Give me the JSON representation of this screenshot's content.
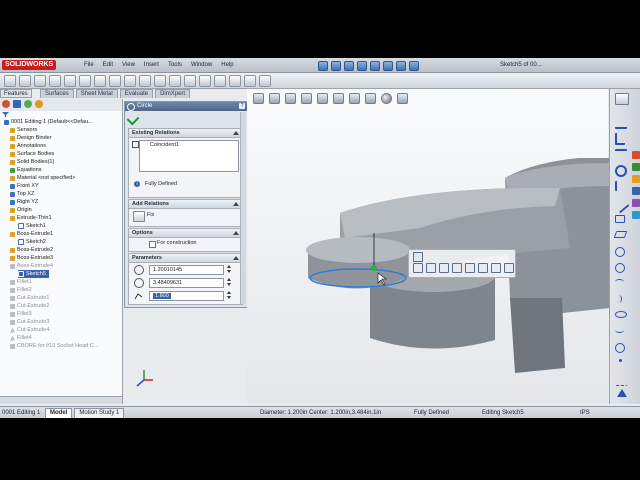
{
  "app": {
    "name": "SOLIDWORKS"
  },
  "menu": [
    "File",
    "Edit",
    "View",
    "Insert",
    "Tools",
    "Window",
    "Help"
  ],
  "document_title": "Sketch5 of 00...",
  "command_tabs": [
    "Features",
    "Surfaces",
    "Sheet Metal",
    "Evaluate",
    "DimXpert"
  ],
  "tree": {
    "root": "0001 Editing 1 (Default<<Defau...",
    "items": [
      {
        "label": "Sensors",
        "state": "normal"
      },
      {
        "label": "Design Binder",
        "state": "normal"
      },
      {
        "label": "Annotations",
        "state": "normal"
      },
      {
        "label": "Surface Bodies",
        "state": "normal"
      },
      {
        "label": "Solid Bodies(1)",
        "state": "normal"
      },
      {
        "label": "Equations",
        "state": "normal"
      },
      {
        "label": "Material <not specified>",
        "state": "normal"
      },
      {
        "label": "Front XY",
        "state": "normal"
      },
      {
        "label": "Top XZ",
        "state": "normal"
      },
      {
        "label": "Right YZ",
        "state": "normal"
      },
      {
        "label": "Origin",
        "state": "normal"
      },
      {
        "label": "Extrude-Thin1",
        "state": "normal"
      },
      {
        "label": "Sketch1",
        "state": "normal"
      },
      {
        "label": "Boss-Extrude1",
        "state": "normal"
      },
      {
        "label": "Sketch2",
        "state": "normal"
      },
      {
        "label": "Boss-Extrude2",
        "state": "normal"
      },
      {
        "label": "Boss-Extrude3",
        "state": "normal"
      },
      {
        "label": "Boss-Extrude4",
        "state": "dim"
      },
      {
        "label": "Sketch5",
        "state": "selected"
      },
      {
        "label": "Fillet1",
        "state": "dim"
      },
      {
        "label": "Fillet2",
        "state": "dim"
      },
      {
        "label": "Cut-Extrude1",
        "state": "dim"
      },
      {
        "label": "Cut-Extrude2",
        "state": "dim"
      },
      {
        "label": "Fillet3",
        "state": "dim"
      },
      {
        "label": "Cut-Extrude3",
        "state": "dim"
      },
      {
        "label": "Cut-Extrude4",
        "state": "dim"
      },
      {
        "label": "Fillet4",
        "state": "dim"
      },
      {
        "label": "CBORE for #10 Socket Head C...",
        "state": "dim"
      }
    ]
  },
  "property_manager": {
    "title": "Circle",
    "help": "?",
    "existing_relations": {
      "title": "Existing Relations",
      "items": [
        "Coincident1"
      ],
      "status": "Fully Defined"
    },
    "add_relations": {
      "title": "Add Relations",
      "items": [
        "Fix"
      ]
    },
    "options": {
      "title": "Options",
      "for_construction": "For construction"
    },
    "parameters": {
      "title": "Parameters",
      "center_x": "1.20010145",
      "center_y": "3.48409631",
      "radius": "1.600"
    }
  },
  "model_tabs": [
    "Model",
    "Motion Study 1"
  ],
  "status": {
    "left": "0001 Editing 1",
    "info": "Diameter: 1.200in  Center: 1.200in,3.484in,1in",
    "state": "Fully Defined",
    "editing": "Editing Sketch5",
    "units": "IPS"
  },
  "colors": {
    "accent": "#3a62a8",
    "model": "#8a9097",
    "brand": "#c81e1e"
  }
}
